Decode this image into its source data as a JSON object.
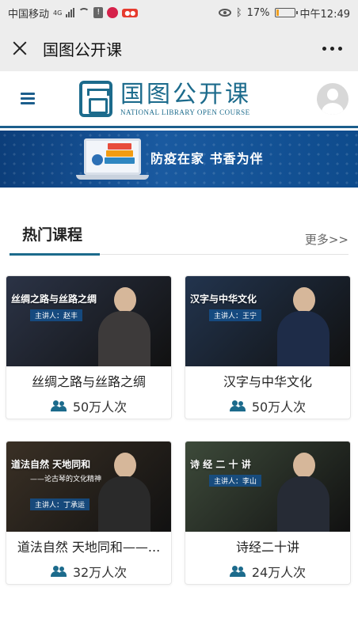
{
  "status_bar": {
    "carrier": "中国移动",
    "network": "4G",
    "battery": "17%",
    "battery_level": 0.17,
    "time": "中午12:49"
  },
  "title_bar": {
    "title": "国图公开课",
    "close_icon": "close-icon",
    "more_icon": "more-dots-icon"
  },
  "site_header": {
    "logo_cn": "国图公开课",
    "logo_en": "NATIONAL LIBRARY OPEN COURSE"
  },
  "banner": {
    "text": "防疫在家  书香为伴"
  },
  "section": {
    "title": "热门课程",
    "more": "更多>>"
  },
  "courses": [
    {
      "title": "丝绸之路与丝路之绸",
      "views": "50万人次",
      "thumb_title": "丝绸之路与丝路之绸",
      "thumb_lecturer": "主讲人：赵丰",
      "thumb_bg": "#2b3346"
    },
    {
      "title": "汉字与中华文化",
      "views": "50万人次",
      "thumb_title": "汉字与中华文化",
      "thumb_lecturer": "主讲人：王宁",
      "thumb_bg": "#22344e"
    },
    {
      "title": "道法自然 天地同和——...",
      "views": "32万人次",
      "thumb_title": "道法自然  天地同和",
      "thumb_sub": "——论古琴的文化精神",
      "thumb_lecturer": "主讲人：丁承运",
      "thumb_bg": "#3a3025"
    },
    {
      "title": "诗经二十讲",
      "views": "24万人次",
      "thumb_title": "诗 经 二 十 讲",
      "thumb_lecturer": "主讲人：李山",
      "thumb_bg": "#3d4a3a"
    }
  ],
  "colors": {
    "brand": "#1c6b8c",
    "banner": "#0c3e7a",
    "status_bar_bg": "#ededed"
  }
}
